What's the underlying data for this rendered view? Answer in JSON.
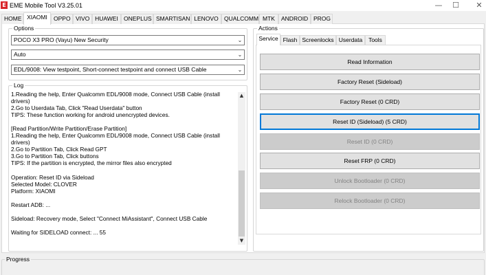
{
  "window": {
    "title": "EME Mobile Tool V3.25.01",
    "app_icon_glyph": "E",
    "minimize": "—",
    "maximize": "☐",
    "close": "✕"
  },
  "tabs": [
    "HOME",
    "XIAOMI",
    "OPPO",
    "VIVO",
    "HUAWEI",
    "ONEPLUS",
    "SMARTISAN",
    "LENOVO",
    "QUALCOMM",
    "MTK",
    "ANDROID",
    "PROG"
  ],
  "active_tab": "XIAOMI",
  "options": {
    "label": "Options",
    "model": "POCO X3 PRO (Vayu) New Security",
    "mode": "Auto",
    "method": "EDL/9008: View testpoint, Short-connect testpoint and connect USB Cable"
  },
  "log": {
    "label": "Log",
    "lines": [
      "1.Reading the help, Enter Qualcomm EDL/9008 mode, Connect USB Cable (install",
      "drivers)",
      "2.Go to Userdata Tab, Click \"Read Userdata\" button",
      "TIPS: These function working for android unencrypted devices.",
      "",
      "[Read Partition/Write Partition/Erase Partition]",
      "1.Reading the help, Enter Qualcomm EDL/9008 mode, Connect USB Cable (install",
      "drivers)",
      "2.Go to Partition Tab, Click Read GPT",
      "3.Go to Partition Tab, Click buttons",
      "TIPS: If the partition is encrypted, the mirror files also encrypted",
      "",
      "Operation: Reset ID via Sideload",
      "Selected Model: CLOVER",
      "Platform: XIAOMI",
      "",
      "Restart ADB: ...",
      "",
      "Sideload: Recovery mode, Select \"Connect MiAssistant\", Connect USB Cable",
      "",
      "Waiting for SIDELOAD connect: ... 55"
    ],
    "scroll_up": "▲",
    "scroll_down": "▼"
  },
  "actions": {
    "label": "Actions",
    "subtabs": [
      "Service",
      "Flash",
      "Screenlocks",
      "Userdata",
      "Tools"
    ],
    "active_subtab": "Service",
    "buttons": [
      {
        "label": "Read Information",
        "state": "enabled"
      },
      {
        "label": "Factory Reset (Sideload)",
        "state": "enabled"
      },
      {
        "label": "Factory Reset (0 CRD)",
        "state": "enabled"
      },
      {
        "label": "Reset ID (Sideload) (5 CRD)",
        "state": "focused"
      },
      {
        "label": "Reset ID (0 CRD)",
        "state": "disabled"
      },
      {
        "label": "Reset FRP (0 CRD)",
        "state": "enabled"
      },
      {
        "label": "Unlock Bootloader (0 CRD)",
        "state": "disabled"
      },
      {
        "label": "Relock Bootloader (0 CRD)",
        "state": "disabled"
      }
    ]
  },
  "progress": {
    "label": "Progress"
  },
  "icons": {
    "combo_arrow": "chevron-down-icon",
    "app": "eme-app-icon"
  }
}
